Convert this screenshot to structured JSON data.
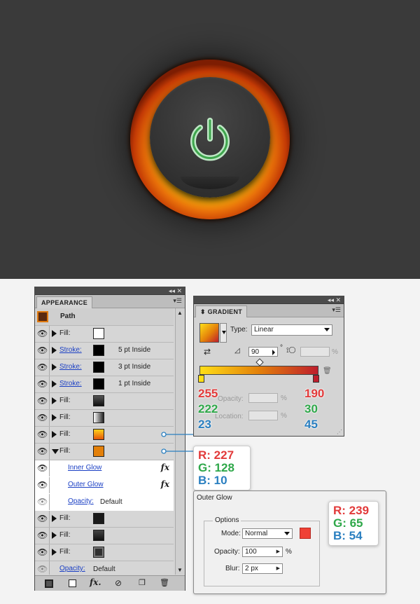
{
  "appearance": {
    "tab": "APPEARANCE",
    "path_label": "Path",
    "rows": [
      {
        "type": "fill",
        "label": "Fill:",
        "swatch": "#ffffff",
        "link": false
      },
      {
        "type": "stroke",
        "label": "Stroke:",
        "swatch": "#000000",
        "value": "5 pt  Inside",
        "link": true
      },
      {
        "type": "stroke",
        "label": "Stroke:",
        "swatch": "#000000",
        "value": "3 pt  Inside",
        "link": true
      },
      {
        "type": "stroke",
        "label": "Stroke:",
        "swatch": "#000000",
        "value": "1 pt  Inside",
        "link": true
      },
      {
        "type": "fill",
        "label": "Fill:",
        "swatch": "gradient-dark"
      },
      {
        "type": "fill",
        "label": "Fill:",
        "swatch": "gradient-light"
      },
      {
        "type": "fill",
        "label": "Fill:",
        "swatch": "gradient-orange"
      },
      {
        "type": "fill",
        "label": "Fill:",
        "swatch": "#e3800a",
        "expanded": true
      },
      {
        "type": "effect",
        "label": "Inner Glow"
      },
      {
        "type": "effect",
        "label": "Outer Glow"
      },
      {
        "type": "opacity",
        "label": "Opacity:",
        "value": "Default"
      },
      {
        "type": "fill",
        "label": "Fill:",
        "swatch": "#1a1a1a"
      },
      {
        "type": "fill",
        "label": "Fill:",
        "swatch": "#2a2a2a"
      },
      {
        "type": "fill",
        "label": "Fill:",
        "swatch": "#303030"
      },
      {
        "type": "opacity",
        "label": "Opacity:",
        "value": "Default"
      }
    ],
    "effect_label": "fx"
  },
  "gradient": {
    "tab": "GRADIENT",
    "type_label": "Type:",
    "type_value": "Linear",
    "angle_value": "90",
    "degree_sign": "°",
    "percent_sign": "%",
    "opacity_label": "Opacity:",
    "location_label": "Location:",
    "stop_left": {
      "r": "255",
      "g": "222",
      "b": "23"
    },
    "stop_right": {
      "r": "190",
      "g": "30",
      "b": "45"
    }
  },
  "callout_fill": {
    "r": "R: 227",
    "g": "G: 128",
    "b": "B: 10"
  },
  "outer_glow": {
    "title": "Outer Glow",
    "options_label": "Options",
    "mode_label": "Mode:",
    "mode_value": "Normal",
    "opacity_label": "Opacity:",
    "opacity_value": "100",
    "opacity_unit": "%",
    "blur_label": "Blur:",
    "blur_value": "2 px",
    "color": "#ef4136",
    "callout": {
      "r": "R: 239",
      "g": "G: 65",
      "b": "B: 54"
    }
  }
}
